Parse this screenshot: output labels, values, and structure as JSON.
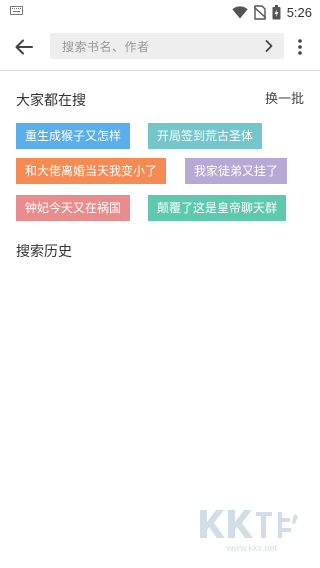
{
  "status_bar": {
    "time": "5:26",
    "icons": [
      "keyboard-icon",
      "wifi-icon",
      "no-sim-icon",
      "battery-icon"
    ]
  },
  "top_bar": {
    "back_icon": "arrow-left-icon",
    "search_placeholder": "搜索书名、作者",
    "chevron_icon": "chevron-right-icon",
    "more_icon": "more-vertical-icon"
  },
  "hot_search": {
    "title": "大家都在搜",
    "refresh_label": "换一批",
    "tags": [
      {
        "label": "重生成猴子又怎样",
        "color": "#5aaeea"
      },
      {
        "label": "开局签到荒古圣体",
        "color": "#73c6cc"
      },
      {
        "label": "和大佬离婚当天我变小了",
        "color": "#f58a52"
      },
      {
        "label": "我家徒弟又挂了",
        "color": "#b8a8d6"
      },
      {
        "label": "钟妃今天又在祸国",
        "color": "#e98c8e"
      },
      {
        "label": "颠覆了这是皇帝聊天群",
        "color": "#5fc9b0"
      }
    ]
  },
  "history": {
    "title": "搜索历史"
  },
  "watermark": {
    "text": "www.kkx.net"
  }
}
